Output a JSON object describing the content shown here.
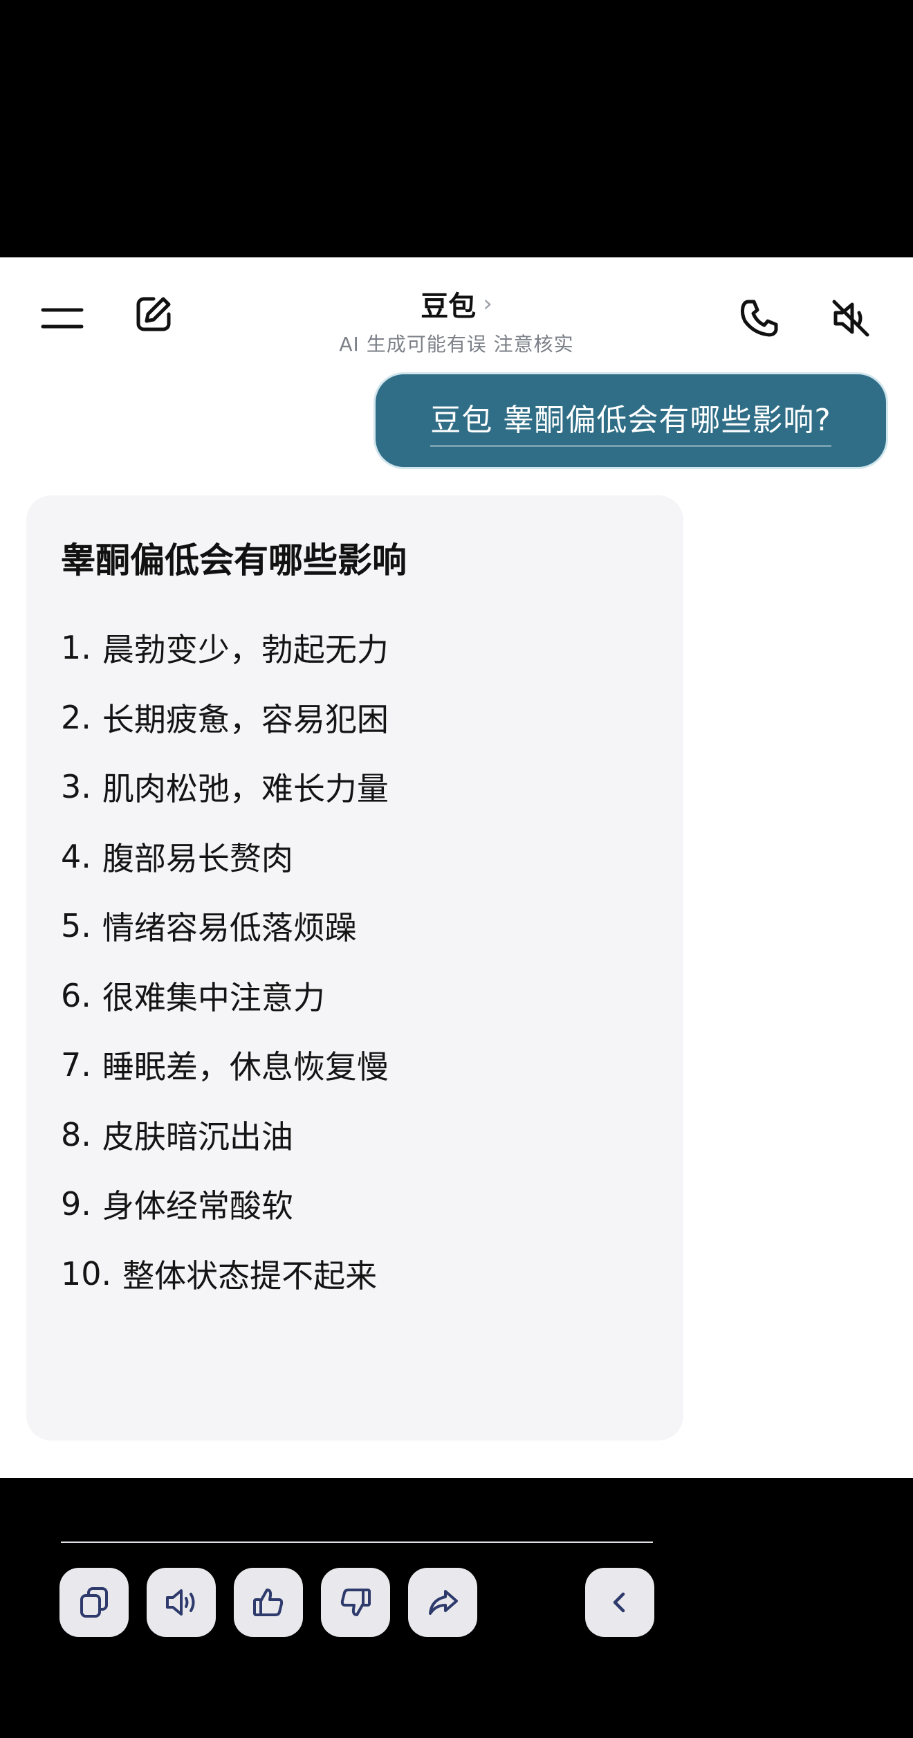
{
  "header": {
    "title": "豆包",
    "title_chevron": "›",
    "subtitle": "AI 生成可能有误 注意核实",
    "icons": [
      "menu-icon",
      "edit-icon",
      "phone-icon",
      "speaker-mute-icon"
    ]
  },
  "user_message": "豆包 睾酮偏低会有哪些影响?",
  "answer": {
    "title": "睾酮偏低会有哪些影响",
    "items": [
      {
        "num": "1.",
        "text": "晨勃变少，勃起无力"
      },
      {
        "num": "2.",
        "text": "长期疲惫，容易犯困"
      },
      {
        "num": "3.",
        "text": "肌肉松弛，难长力量"
      },
      {
        "num": "4.",
        "text": "腹部易长赘肉"
      },
      {
        "num": "5.",
        "text": "情绪容易低落烦躁"
      },
      {
        "num": "6.",
        "text": "很难集中注意力"
      },
      {
        "num": "7.",
        "text": "睡眠差，休息恢复慢"
      },
      {
        "num": "8.",
        "text": "皮肤暗沉出油"
      },
      {
        "num": "9.",
        "text": "身体经常酸软"
      },
      {
        "num": "10.",
        "text": "整体状态提不起来"
      }
    ],
    "actions": [
      "copy-icon",
      "read-aloud-icon",
      "thumbs-up-icon",
      "thumbs-down-icon",
      "share-icon",
      "chevron-left-icon"
    ]
  },
  "colors": {
    "user_bubble": "#2f6e86",
    "card_bg": "#f5f5f7",
    "icon_stroke": "#2d3a6b"
  }
}
